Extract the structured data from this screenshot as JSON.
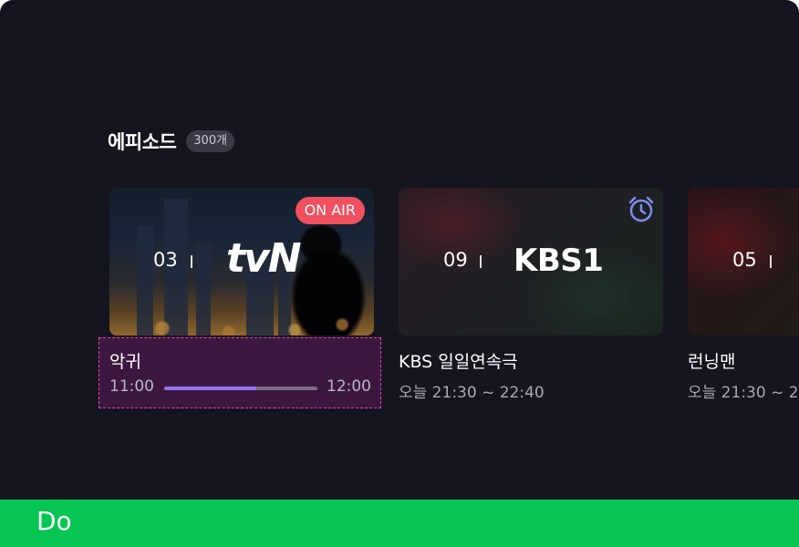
{
  "section": {
    "title": "에피소드",
    "count": "300개"
  },
  "cards": [
    {
      "episode": "03",
      "channel_logo": "tvN",
      "badge": "ON AIR",
      "title": "악귀",
      "start": "11:00",
      "end": "12:00",
      "progress": 0.6
    },
    {
      "episode": "09",
      "channel_logo": "KBS1",
      "icon": "alarm-clock-icon",
      "title": "KBS 일일연속극",
      "subtitle": "오늘 21:30 ~ 22:40"
    },
    {
      "episode": "05",
      "title": "런닝맨",
      "subtitle": "오늘 21:30 ~ 2"
    }
  ],
  "footer": {
    "label": "Do"
  },
  "colors": {
    "background": "#15151f",
    "onair": "#f0505f",
    "progress": "#8f78f0",
    "alarm": "#7f8cf0",
    "focus_border": "#e23fbd",
    "focus_fill": "#3c1840",
    "footer": "#06c553"
  }
}
